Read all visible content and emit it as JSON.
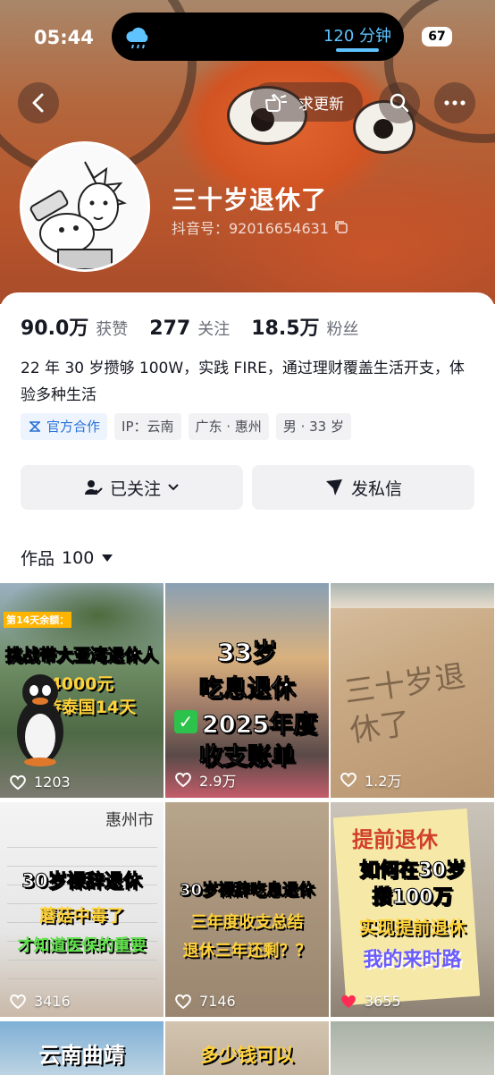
{
  "status_bar": {
    "time": "05:44",
    "activity_text": "120 分钟",
    "battery": "67"
  },
  "nav": {
    "request_update_label": "求更新"
  },
  "profile": {
    "name": "三十岁退休了",
    "douyin_id": "抖音号：92016654631",
    "stats": [
      {
        "value": "90.0万",
        "label": "获赞"
      },
      {
        "value": "277",
        "label": "关注"
      },
      {
        "value": "18.5万",
        "label": "粉丝"
      }
    ],
    "bio": "22 年 30 岁攒够 100W，实践 FIRE，通过理财覆盖生活开支，体验多种生活",
    "tags": [
      "官方合作",
      "IP：云南",
      "广东 · 惠州",
      "男 · 33 岁"
    ]
  },
  "actions": {
    "follow_label": "已关注",
    "message_label": "发私信"
  },
  "works": {
    "label": "作品",
    "count": "100"
  },
  "videos": [
    {
      "likes": "1203",
      "liked": false,
      "caption_top": "第14天余额：",
      "lines": [
        "挑战带大亚湾退休人",
        "4000元",
        "富游泰国14天"
      ]
    },
    {
      "likes": "2.9万",
      "liked": false,
      "lines": [
        "33岁",
        "吃息退休",
        "2025年度",
        "收支账单"
      ]
    },
    {
      "likes": "1.2万",
      "liked": false,
      "sand_text": "三十岁退休了"
    },
    {
      "likes": "3416",
      "liked": false,
      "lines": [
        "30岁裸辞退休",
        "蘑菇中毒了",
        "才知道医保的重要"
      ],
      "paper_text": "惠州市"
    },
    {
      "likes": "7146",
      "liked": false,
      "lines": [
        "30岁裸辞吃息退休",
        "三年度收支总结",
        "退休三年还剩？？"
      ]
    },
    {
      "likes": "3655",
      "liked": true,
      "lines": [
        "如何在30岁",
        "攒100万",
        "实现提前退休",
        "我的来时路"
      ],
      "book_text": "提前退休"
    },
    {
      "lines": [
        "云南曲靖"
      ]
    },
    {
      "lines": [
        "多少钱可以"
      ]
    },
    {
      "lines": []
    }
  ],
  "colors": {
    "accent_blue": "#2a72d8",
    "like_red": "#fe2c55",
    "island_blue": "#5ec3ff"
  }
}
